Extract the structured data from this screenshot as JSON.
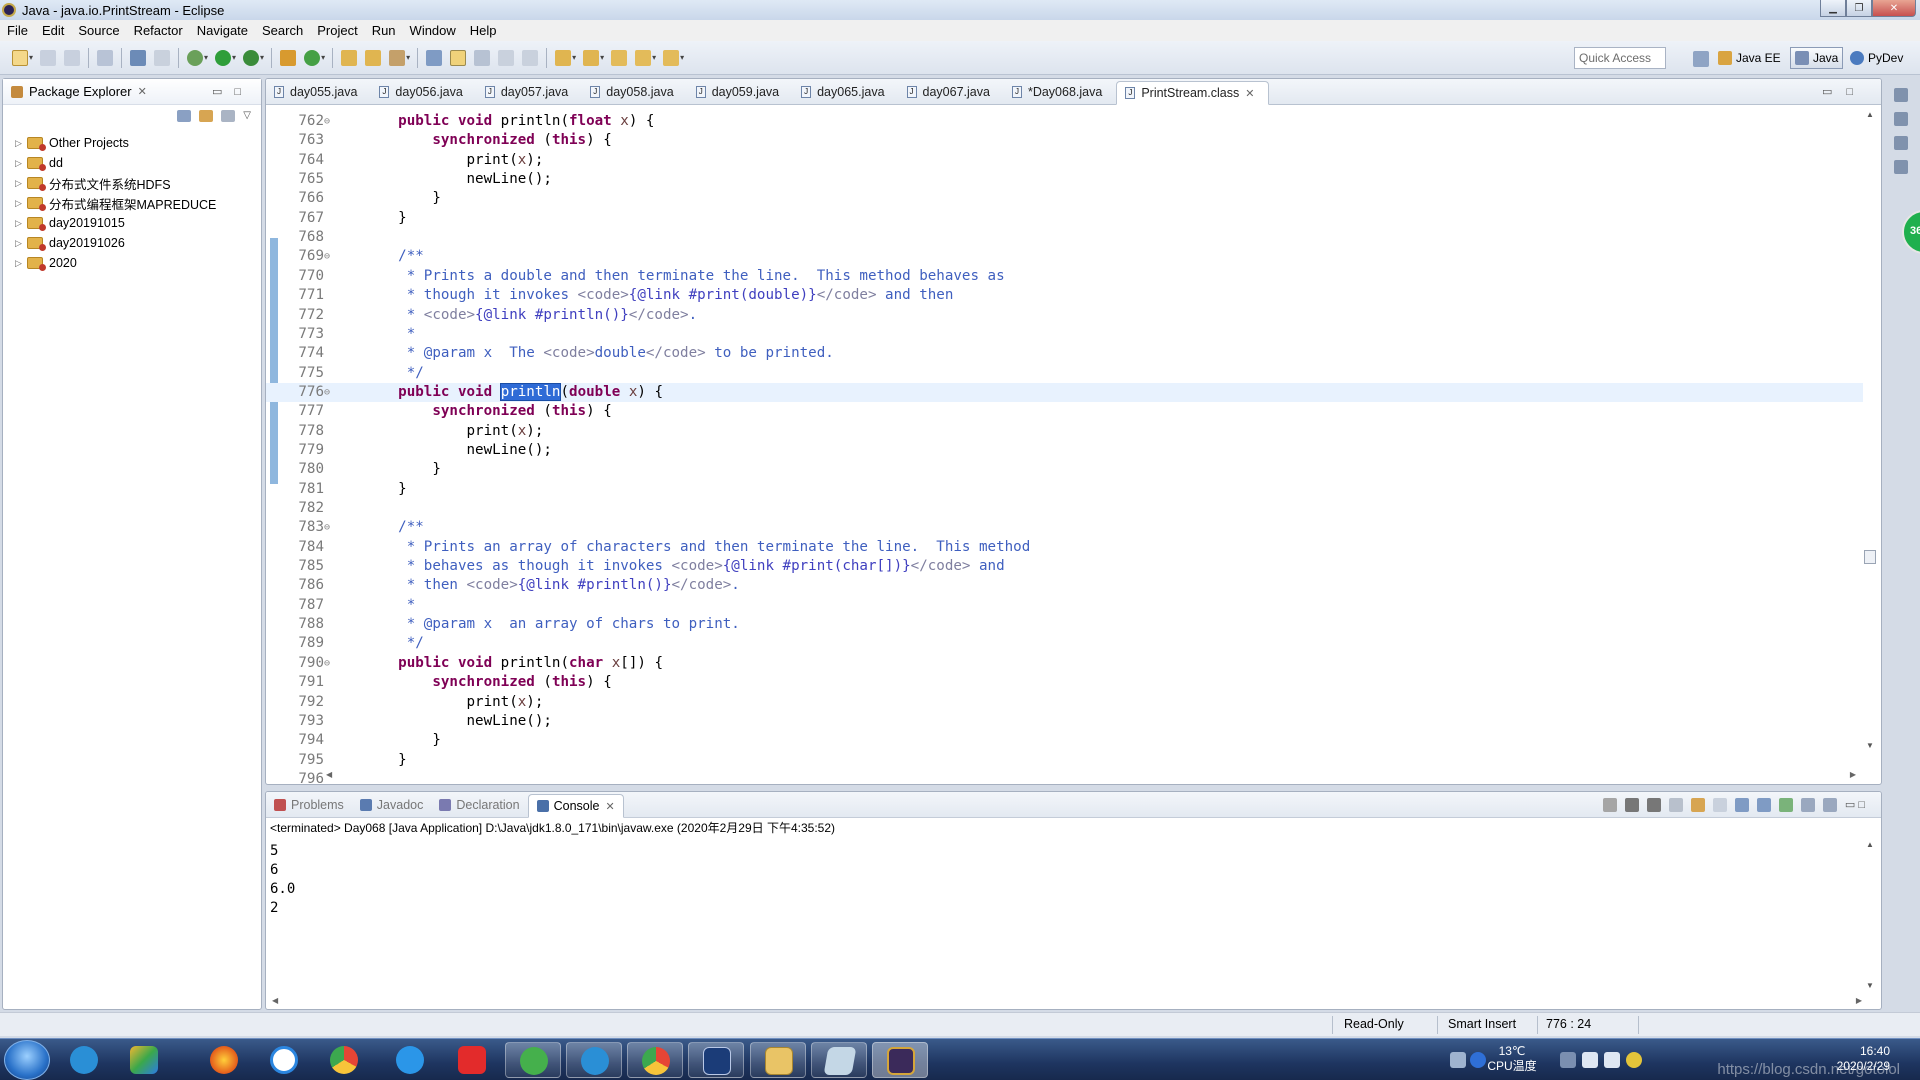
{
  "window": {
    "title": "Java - java.io.PrintStream - Eclipse"
  },
  "menu": [
    "File",
    "Edit",
    "Source",
    "Refactor",
    "Navigate",
    "Search",
    "Project",
    "Run",
    "Window",
    "Help"
  ],
  "toolbar": {
    "quick_access_placeholder": "Quick Access",
    "perspectives": [
      {
        "label": "Java EE",
        "active": false
      },
      {
        "label": "Java",
        "active": true
      },
      {
        "label": "PyDev",
        "active": false
      }
    ]
  },
  "package_explorer": {
    "title": "Package Explorer",
    "items": [
      "Other Projects",
      "dd",
      "分布式文件系统HDFS",
      "分布式编程框架MAPREDUCE",
      "day20191015",
      "day20191026",
      "2020"
    ]
  },
  "editor": {
    "tabs": [
      {
        "label": "day055.java",
        "active": false
      },
      {
        "label": "day056.java",
        "active": false
      },
      {
        "label": "day057.java",
        "active": false
      },
      {
        "label": "day058.java",
        "active": false
      },
      {
        "label": "day059.java",
        "active": false
      },
      {
        "label": "day065.java",
        "active": false
      },
      {
        "label": "day067.java",
        "active": false
      },
      {
        "label": "*Day068.java",
        "active": false
      },
      {
        "label": "PrintStream.class",
        "active": true
      }
    ],
    "current_line": 776,
    "lines": [
      {
        "n": "762",
        "fold": true,
        "html": "    <span class=\"kw\">public void</span> println(<span class=\"kw\">float</span> <span class=\"par\">x</span>) {"
      },
      {
        "n": "763",
        "html": "        <span class=\"kw\">synchronized</span> (<span class=\"kw\">this</span>) {"
      },
      {
        "n": "764",
        "html": "            print(<span class=\"par\">x</span>);"
      },
      {
        "n": "765",
        "html": "            newLine();"
      },
      {
        "n": "766",
        "html": "        }"
      },
      {
        "n": "767",
        "html": "    }"
      },
      {
        "n": "768",
        "html": ""
      },
      {
        "n": "769",
        "fold": true,
        "html": "    <span class=\"cm\">/**</span>"
      },
      {
        "n": "770",
        "html": "<span class=\"cm\">     * Prints a double and then terminate the line.  This method behaves as</span>"
      },
      {
        "n": "771",
        "html": "<span class=\"cm\">     * though it invokes </span><span class=\"tag\">&lt;code&gt;</span><span class=\"lnk\">{@link #print(double)}</span><span class=\"tag\">&lt;/code&gt;</span><span class=\"cm\"> and then</span>"
      },
      {
        "n": "772",
        "html": "<span class=\"cm\">     * </span><span class=\"tag\">&lt;code&gt;</span><span class=\"lnk\">{@link #println()}</span><span class=\"tag\">&lt;/code&gt;</span><span class=\"cm\">.</span>"
      },
      {
        "n": "773",
        "html": "<span class=\"cm\">     *</span>"
      },
      {
        "n": "774",
        "html": "<span class=\"cm\">     * @param x  The </span><span class=\"tag\">&lt;code&gt;</span><span class=\"cm\">double</span><span class=\"tag\">&lt;/code&gt;</span><span class=\"cm\"> to be printed.</span>"
      },
      {
        "n": "775",
        "html": "<span class=\"cm\">     */</span>"
      },
      {
        "n": "776",
        "fold": true,
        "html": "    <span class=\"kw\">public void</span> <span class=\"hl\">println</span>(<span class=\"kw\">double</span> <span class=\"par\">x</span>) {"
      },
      {
        "n": "777",
        "html": "        <span class=\"kw\">synchronized</span> (<span class=\"kw\">this</span>) {"
      },
      {
        "n": "778",
        "html": "            print(<span class=\"par\">x</span>);"
      },
      {
        "n": "779",
        "html": "            newLine();"
      },
      {
        "n": "780",
        "html": "        }"
      },
      {
        "n": "781",
        "html": "    }"
      },
      {
        "n": "782",
        "html": ""
      },
      {
        "n": "783",
        "fold": true,
        "html": "    <span class=\"cm\">/**</span>"
      },
      {
        "n": "784",
        "html": "<span class=\"cm\">     * Prints an array of characters and then terminate the line.  This method</span>"
      },
      {
        "n": "785",
        "html": "<span class=\"cm\">     * behaves as though it invokes </span><span class=\"tag\">&lt;code&gt;</span><span class=\"lnk\">{@link #print(char[])}</span><span class=\"tag\">&lt;/code&gt;</span><span class=\"cm\"> and</span>"
      },
      {
        "n": "786",
        "html": "<span class=\"cm\">     * then </span><span class=\"tag\">&lt;code&gt;</span><span class=\"lnk\">{@link #println()}</span><span class=\"tag\">&lt;/code&gt;</span><span class=\"cm\">.</span>"
      },
      {
        "n": "787",
        "html": "<span class=\"cm\">     *</span>"
      },
      {
        "n": "788",
        "html": "<span class=\"cm\">     * @param x  an array of chars to print.</span>"
      },
      {
        "n": "789",
        "html": "<span class=\"cm\">     */</span>"
      },
      {
        "n": "790",
        "fold": true,
        "html": "    <span class=\"kw\">public void</span> println(<span class=\"kw\">char</span> <span class=\"par\">x</span>[]) {"
      },
      {
        "n": "791",
        "html": "        <span class=\"kw\">synchronized</span> (<span class=\"kw\">this</span>) {"
      },
      {
        "n": "792",
        "html": "            print(<span class=\"par\">x</span>);"
      },
      {
        "n": "793",
        "html": "            newLine();"
      },
      {
        "n": "794",
        "html": "        }"
      },
      {
        "n": "795",
        "html": "    }"
      },
      {
        "n": "796",
        "html": ""
      }
    ]
  },
  "bottom_panel": {
    "tabs": [
      {
        "label": "Problems",
        "active": false
      },
      {
        "label": "Javadoc",
        "active": false
      },
      {
        "label": "Declaration",
        "active": false
      },
      {
        "label": "Console",
        "active": true
      }
    ],
    "status": "<terminated> Day068 [Java Application] D:\\Java\\jdk1.8.0_171\\bin\\javaw.exe (2020年2月29日 下午4:35:52)",
    "output": [
      "5",
      "6",
      "6.0",
      "2"
    ]
  },
  "statusbar": {
    "mode": "Read-Only",
    "insert": "Smart Insert",
    "position": "776 : 24"
  },
  "side_badge": "36",
  "taskbar": {
    "temperature": "13℃",
    "cpu_label": "CPU温度",
    "time": "16:40",
    "date": "2020/2/29",
    "watermark": "https://blog.csdn.net/gotolol"
  }
}
